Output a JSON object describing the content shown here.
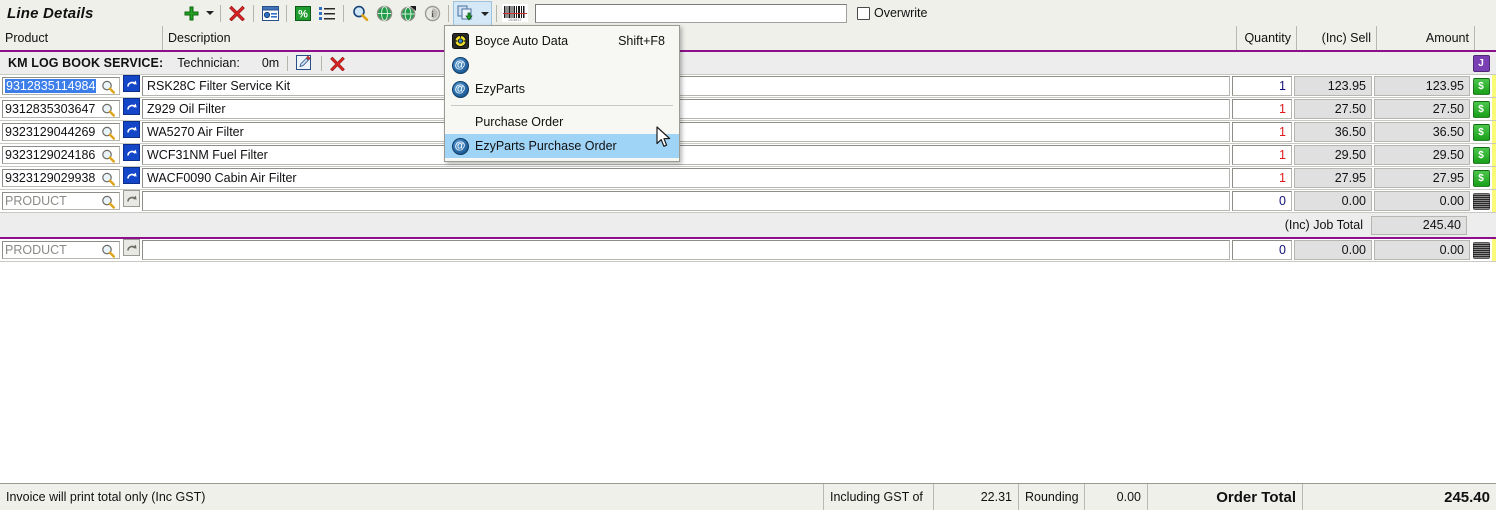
{
  "window": {
    "title": "Line Details"
  },
  "toolbar": {
    "buttons": [
      {
        "name": "add-line-button",
        "icon": "plus-icon"
      },
      {
        "name": "add-line-dropdown",
        "icon": "chevron-down-icon"
      },
      {
        "name": "delete-line-button",
        "icon": "red-x-icon"
      },
      {
        "name": "line-properties-button",
        "icon": "properties-window-icon"
      },
      {
        "name": "discount-percent-button",
        "icon": "percent-icon"
      },
      {
        "name": "line-list-button",
        "icon": "bullet-list-icon"
      },
      {
        "name": "find-button",
        "icon": "magnifier-icon"
      },
      {
        "name": "web-lookup-button",
        "icon": "globe-icon"
      },
      {
        "name": "web-lookup-alt-button",
        "icon": "globe-arrow-icon"
      },
      {
        "name": "info-button",
        "icon": "info-circle-icon"
      },
      {
        "name": "order-source-button",
        "icon": "copy-down-icon"
      },
      {
        "name": "order-source-dropdown",
        "icon": "chevron-down-icon"
      },
      {
        "name": "barcode-button",
        "icon": "barcode-icon"
      }
    ],
    "search": {
      "value": "",
      "placeholder": ""
    },
    "overwrite": {
      "label": "Overwrite",
      "checked": false
    }
  },
  "menu": {
    "items": [
      {
        "icon": "boyce-auto-data-icon",
        "label": "Boyce Auto Data",
        "shortcut": "Shift+F8",
        "selected": false,
        "separator_after": false
      },
      {
        "icon": "ezyparts-icon",
        "label": "",
        "shortcut": "",
        "selected": false,
        "separator_after": false
      },
      {
        "icon": "ezyparts-icon",
        "label": "EzyParts",
        "shortcut": "",
        "selected": false,
        "separator_after": true
      },
      {
        "icon": "",
        "label": "Purchase Order",
        "shortcut": "",
        "selected": false,
        "separator_after": false
      },
      {
        "icon": "ezyparts-icon",
        "label": "EzyParts Purchase Order",
        "shortcut": "",
        "selected": true,
        "separator_after": false
      }
    ]
  },
  "grid": {
    "columns": [
      {
        "key": "product",
        "label": "Product",
        "align": "left"
      },
      {
        "key": "description",
        "label": "Description",
        "align": "left"
      },
      {
        "key": "quantity",
        "label": "Quantity",
        "align": "right"
      },
      {
        "key": "sell",
        "label": "(Inc) Sell",
        "align": "right"
      },
      {
        "key": "amount",
        "label": "Amount",
        "align": "right"
      }
    ],
    "job_band": {
      "title": "KM LOG BOOK SERVICE:",
      "technician_label": "Technician:",
      "time": "0m",
      "edit_icon": "edit-pencil-icon",
      "delete_icon": "red-x-icon",
      "status_icon": "job-icon"
    },
    "rows": [
      {
        "product": "9312835114984",
        "description": "RSK28C Filter Service Kit",
        "quantity": "1",
        "qty_color": "blue",
        "sell": "123.95",
        "amount": "123.95",
        "status_icon": "dollar-icon",
        "selected": true,
        "lookup_active": true
      },
      {
        "product": "9312835303647",
        "description": "Z929 Oil Filter",
        "quantity": "1",
        "qty_color": "red",
        "sell": "27.50",
        "amount": "27.50",
        "status_icon": "dollar-icon",
        "selected": false,
        "lookup_active": true
      },
      {
        "product": "9323129044269",
        "description": "WA5270 Air Filter",
        "quantity": "1",
        "qty_color": "red",
        "sell": "36.50",
        "amount": "36.50",
        "status_icon": "dollar-icon",
        "selected": false,
        "lookup_active": true
      },
      {
        "product": "9323129024186",
        "description": "WCF31NM Fuel Filter",
        "quantity": "1",
        "qty_color": "red",
        "sell": "29.50",
        "amount": "29.50",
        "status_icon": "dollar-icon",
        "selected": false,
        "lookup_active": true
      },
      {
        "product": "9323129029938",
        "description": "WACF0090 Cabin Air Filter",
        "quantity": "1",
        "qty_color": "red",
        "sell": "27.95",
        "amount": "27.95",
        "status_icon": "dollar-icon",
        "selected": false,
        "lookup_active": true
      },
      {
        "product": "PRODUCT",
        "description": "",
        "quantity": "0",
        "qty_color": "blue",
        "sell": "0.00",
        "amount": "0.00",
        "status_icon": "grid-icon",
        "selected": false,
        "lookup_active": false,
        "placeholder": true
      }
    ],
    "job_total": {
      "label": "(Inc) Job Total",
      "value": "245.40"
    },
    "new_row": {
      "product": "PRODUCT",
      "description": "",
      "quantity": "0",
      "qty_color": "blue",
      "sell": "0.00",
      "amount": "0.00",
      "status_icon": "grid-icon",
      "placeholder": true
    }
  },
  "status_bar": {
    "message": "Invoice will print total only (Inc GST)",
    "gst_label": "Including GST of",
    "gst_value": "22.31",
    "rounding_label": "Rounding",
    "rounding_value": "0.00",
    "total_label": "Order Total",
    "total_value": "245.40"
  },
  "colors": {
    "accent_purple": "#8c0f8c",
    "selection_blue": "#3d7ee8",
    "menu_highlight": "#9fd4f7",
    "qty_red": "#e01b1b",
    "qty_blue": "#10107a",
    "edge_yellow": "#fbfb7a"
  }
}
